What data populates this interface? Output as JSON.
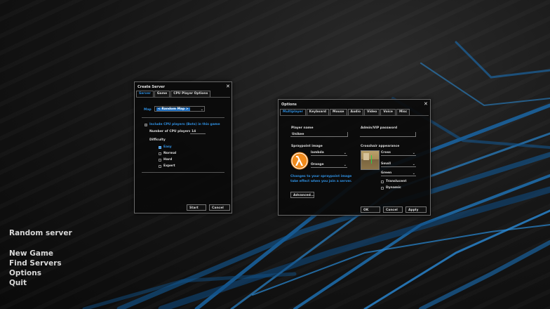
{
  "main_menu": {
    "random_server": "Random server",
    "new_game": "New Game",
    "find_servers": "Find Servers",
    "options": "Options",
    "quit": "Quit"
  },
  "create_server": {
    "title": "Create Server",
    "close": "✕",
    "tabs": [
      "Server",
      "Game",
      "CPU Player Options"
    ],
    "map_label": "Map",
    "map_value": "< Random Map >",
    "include_cpu_label": "Include CPU players (Bots) in this game",
    "num_cpu_label": "Number of CPU players",
    "num_cpu_value": "14",
    "difficulty_label": "Difficulty",
    "difficulty_options": [
      "Easy",
      "Normal",
      "Hard",
      "Expert"
    ],
    "difficulty_selected": "Easy",
    "start": "Start",
    "cancel": "Cancel"
  },
  "options": {
    "title": "Options",
    "close": "✕",
    "tabs": [
      "Multiplayer",
      "Keyboard",
      "Mouse",
      "Audio",
      "Video",
      "Voice",
      "Misc"
    ],
    "player_name_label": "Player name",
    "player_name_value": "Unikee",
    "admin_password_label": "Admin/VIP password",
    "spraypoint_label": "Spraypoint image",
    "spray_image": "lambda",
    "spray_color": "Orange",
    "spray_note": "Changes to your spraypoint image take effect when you join a server.",
    "crosshair_label": "Crosshair appearance",
    "crosshair_type": "Cross",
    "crosshair_size": "Small",
    "crosshair_color": "Green",
    "translucent": "Translucent",
    "dynamic": "Dynamic",
    "advanced": "Advanced...",
    "ok": "OK",
    "cancel": "Cancel",
    "apply": "Apply",
    "accent_color": "#2f8fe0",
    "spray_icon": "lambda-icon"
  }
}
